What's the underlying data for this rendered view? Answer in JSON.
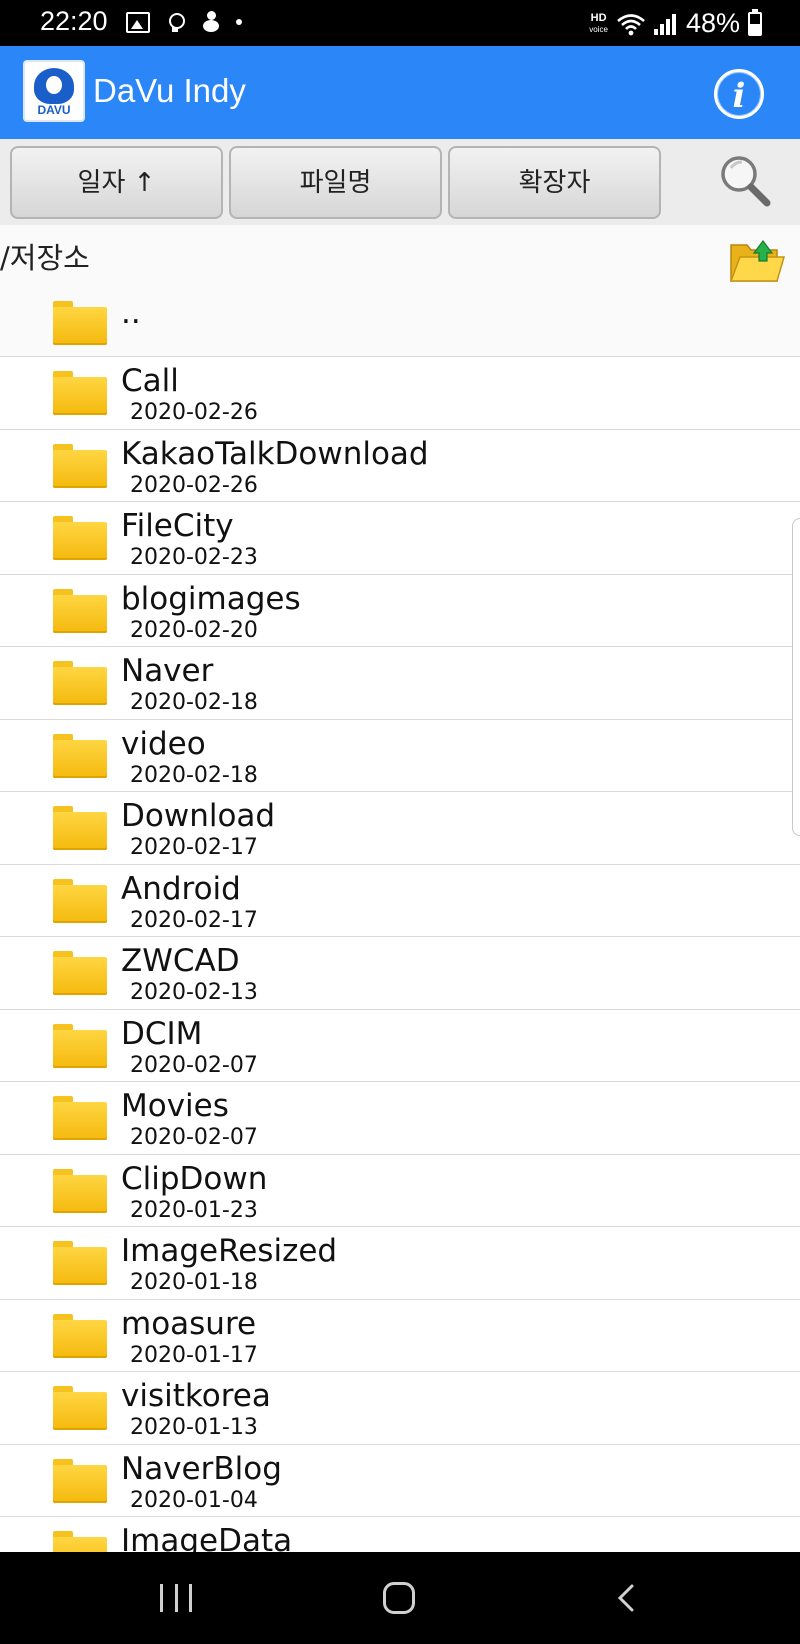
{
  "status_bar": {
    "time": "22:20",
    "hd_label": "HD",
    "voice_label": "voice",
    "battery_percent": "48%"
  },
  "app_bar": {
    "logo_text": "DAVU",
    "title": "DaVu Indy",
    "info_label": "i",
    "brand_color": "#2b86f7"
  },
  "toolbar": {
    "sort_date_label": "일자 ↑",
    "sort_name_label": "파일명",
    "sort_ext_label": "확장자"
  },
  "path": {
    "current": "/저장소"
  },
  "file_list": {
    "parent": {
      "name": ".."
    },
    "items": [
      {
        "name": "Call",
        "date": "2020-02-26"
      },
      {
        "name": "KakaoTalkDownload",
        "date": "2020-02-26"
      },
      {
        "name": "FileCity",
        "date": "2020-02-23"
      },
      {
        "name": "blogimages",
        "date": "2020-02-20"
      },
      {
        "name": "Naver",
        "date": "2020-02-18"
      },
      {
        "name": "video",
        "date": "2020-02-18"
      },
      {
        "name": "Download",
        "date": "2020-02-17"
      },
      {
        "name": "Android",
        "date": "2020-02-17"
      },
      {
        "name": "ZWCAD",
        "date": "2020-02-13"
      },
      {
        "name": "DCIM",
        "date": "2020-02-07"
      },
      {
        "name": "Movies",
        "date": "2020-02-07"
      },
      {
        "name": "ClipDown",
        "date": "2020-01-23"
      },
      {
        "name": "ImageResized",
        "date": "2020-01-18"
      },
      {
        "name": "moasure",
        "date": "2020-01-17"
      },
      {
        "name": "visitkorea",
        "date": "2020-01-13"
      },
      {
        "name": "NaverBlog",
        "date": "2020-01-04"
      },
      {
        "name": "ImageData",
        "date": ""
      }
    ]
  },
  "icons": {
    "folder": "folder-icon",
    "parent_folder": "folder-up-icon",
    "search": "search-icon",
    "info": "info-icon"
  }
}
